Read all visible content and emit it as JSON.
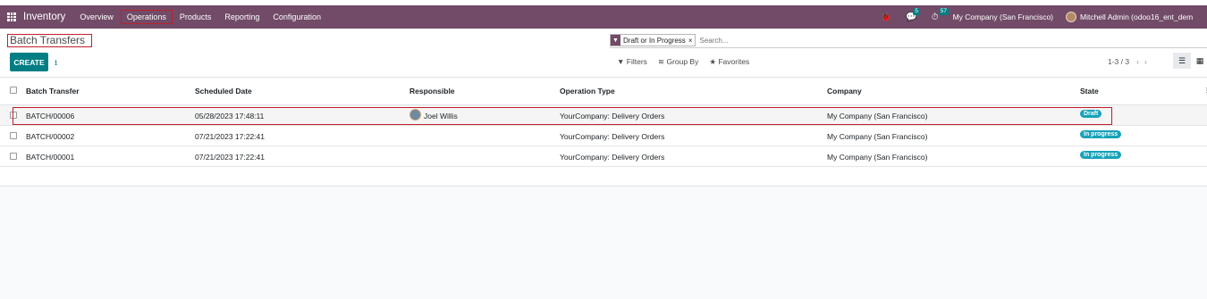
{
  "navbar": {
    "brand": "Inventory",
    "menu": [
      "Overview",
      "Operations",
      "Products",
      "Reporting",
      "Configuration"
    ],
    "chat_count": "5",
    "activity_count": "57",
    "company": "My Company (San Francisco)",
    "user": "Mitchell Admin (odoo16_ent_dem"
  },
  "control": {
    "breadcrumb": "Batch Transfers",
    "facet": "Draft or In Progress",
    "search_placeholder": "Search...",
    "create": "CREATE",
    "filters": "Filters",
    "group_by": "Group By",
    "favorites": "Favorites",
    "pager": "1-3 / 3"
  },
  "table": {
    "headers": [
      "Batch Transfer",
      "Scheduled Date",
      "Responsible",
      "Operation Type",
      "Company",
      "State"
    ],
    "rows": [
      {
        "name": "BATCH/00006",
        "date": "05/28/2023 17:48:11",
        "responsible": "Joel Willis",
        "op": "YourCompany: Delivery Orders",
        "company": "My Company (San Francisco)",
        "state": "Draft"
      },
      {
        "name": "BATCH/00002",
        "date": "07/21/2023 17:22:41",
        "responsible": "",
        "op": "YourCompany: Delivery Orders",
        "company": "My Company (San Francisco)",
        "state": "In progress"
      },
      {
        "name": "BATCH/00001",
        "date": "07/21/2023 17:22:41",
        "responsible": "",
        "op": "YourCompany: Delivery Orders",
        "company": "My Company (San Francisco)",
        "state": "In progress"
      }
    ]
  },
  "colors": {
    "primary": "#714b67",
    "teal": "#017e84",
    "badge": "#17a2b8",
    "highlight": "#c0202b"
  },
  "icons": [
    "apps-icon",
    "bug-icon",
    "chat-icon",
    "clock-icon",
    "filter-icon",
    "download-icon",
    "list-view-icon",
    "kanban-view-icon"
  ]
}
